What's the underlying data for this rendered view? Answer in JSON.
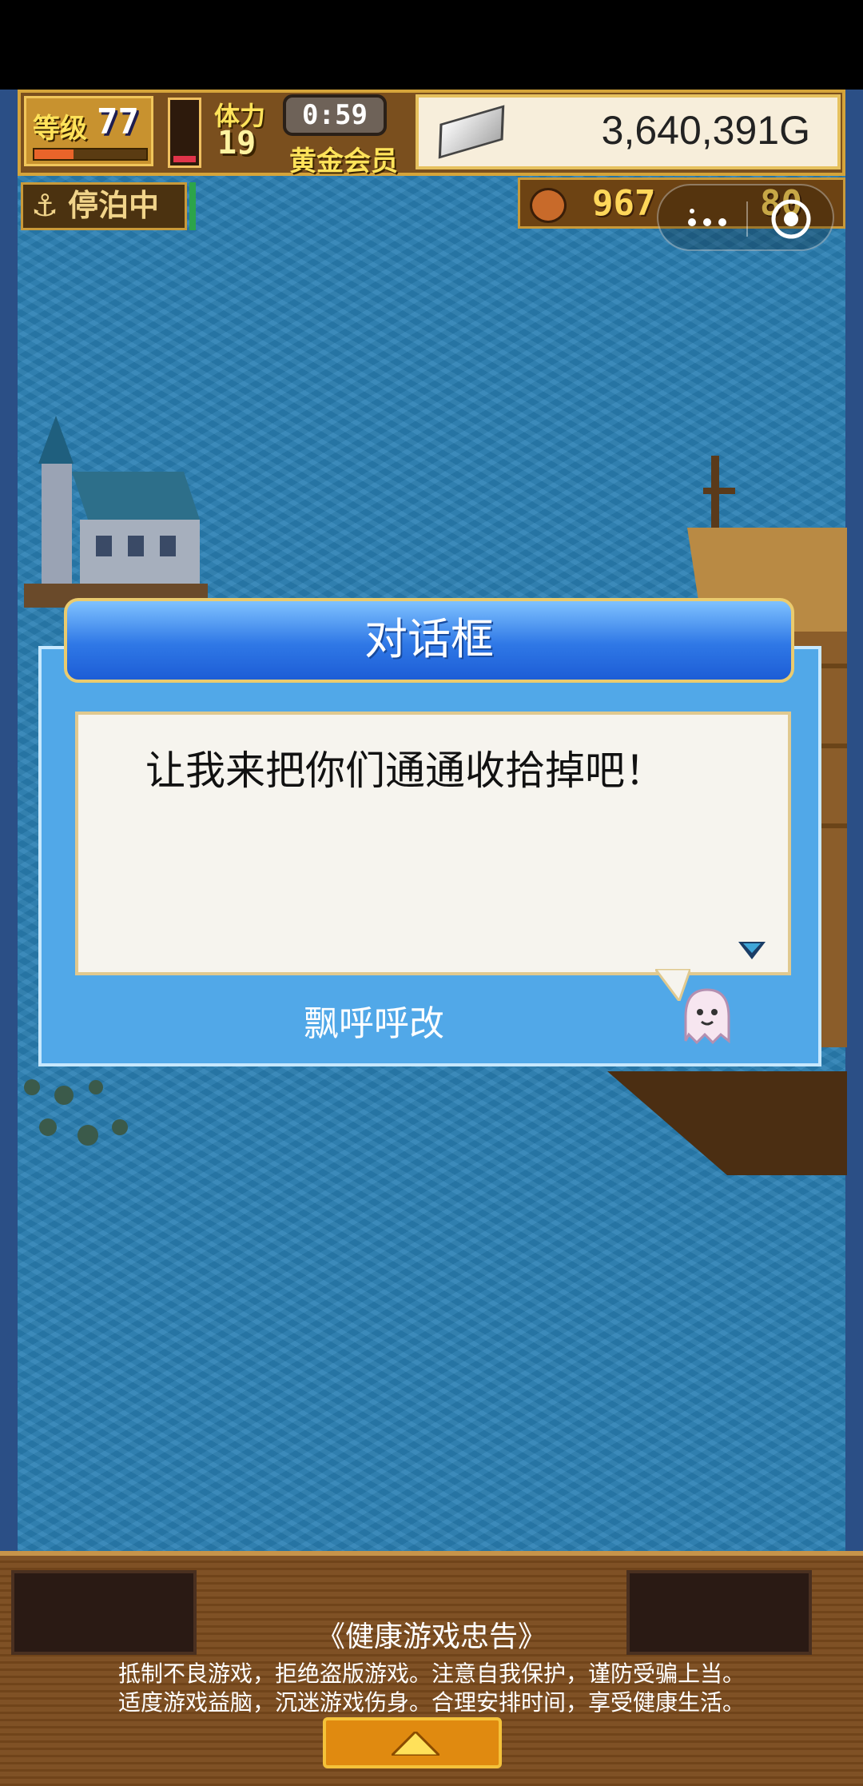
{
  "hud": {
    "level_label": "等级",
    "level_value": "77",
    "exp_fraction": 0.35,
    "stamina_label": "体力",
    "stamina_value": "19",
    "stamina_fraction": 0.2,
    "timer": "0:59",
    "membership": "黄金会员",
    "gold": "3,640,391G",
    "status": "停泊中",
    "food": "967",
    "food2": "80"
  },
  "dialog": {
    "title": "对话框",
    "message": "让我来把你们通通收拾掉吧！",
    "speaker": "飘呼呼改"
  },
  "notice": {
    "title": "《健康游戏忠告》",
    "line1": "抵制不良游戏，拒绝盗版游戏。注意自我保护，谨防受骗上当。",
    "line2": "适度游戏益脑，沉迷游戏伤身。合理安排时间，享受健康生活。"
  },
  "icons": {
    "anchor": "anchor-icon",
    "silver": "silver-bar-icon",
    "food": "food-icon",
    "more": "more-icon",
    "close": "close-target-icon",
    "up": "arrow-up-icon"
  },
  "colors": {
    "dialog_blue": "#51a8e8",
    "header_blue": "#2f78e6",
    "hud_gold": "#d5a43a"
  }
}
